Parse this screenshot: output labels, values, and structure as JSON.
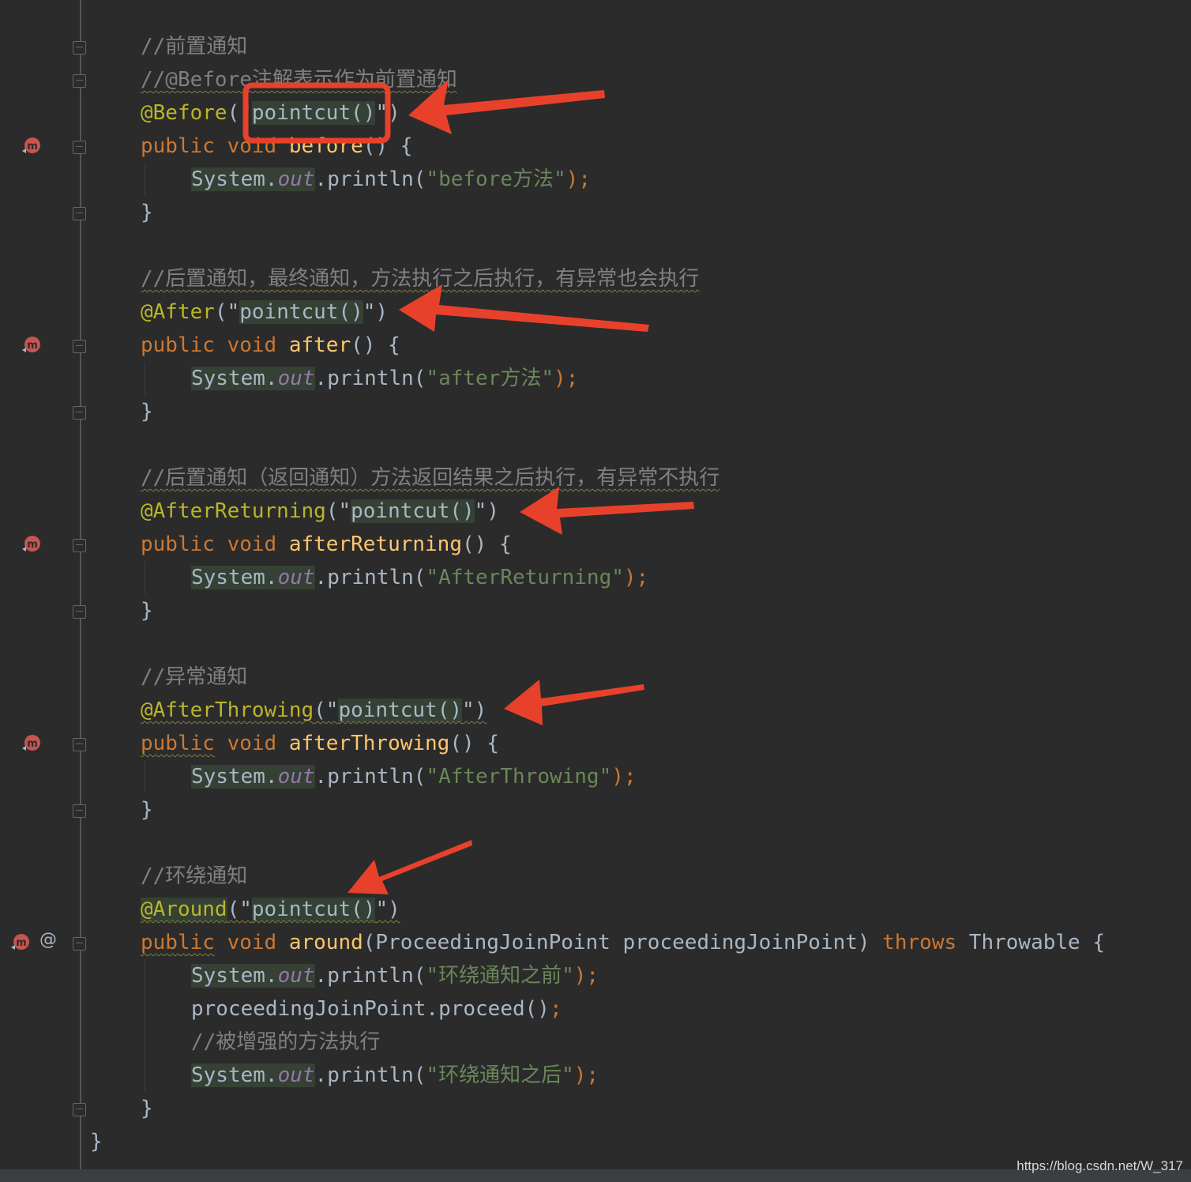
{
  "editor": {
    "lines": [
      {
        "id": "c1",
        "parts": [
          {
            "t": "//前置通知",
            "c": "cmt"
          }
        ]
      },
      {
        "id": "c2",
        "parts": [
          {
            "t": "//@Before注解表示作为前置通知",
            "c": "cmt wavy"
          }
        ]
      },
      {
        "id": "a1",
        "parts": [
          {
            "t": "@Before",
            "c": "ann"
          },
          {
            "t": "(\"",
            "c": "plain"
          },
          {
            "t": "pointcut()",
            "c": "plain hl"
          },
          {
            "t": "\")",
            "c": "plain"
          }
        ]
      },
      {
        "id": "m1",
        "parts": [
          {
            "t": "public void ",
            "c": "kw"
          },
          {
            "t": "before",
            "c": "fn"
          },
          {
            "t": "() {",
            "c": "plain"
          }
        ]
      },
      {
        "id": "s1",
        "parts": [
          {
            "t": "System",
            "c": "plain hl"
          },
          {
            "t": ".",
            "c": "plain hl"
          },
          {
            "t": "out",
            "c": "fld hl"
          },
          {
            "t": ".println(",
            "c": "plain"
          },
          {
            "t": "\"before方法\"",
            "c": "str"
          },
          {
            "t": ");",
            "c": "kw"
          }
        ]
      },
      {
        "id": "e1",
        "parts": [
          {
            "t": "}",
            "c": "plain"
          }
        ]
      },
      {
        "id": "c3",
        "parts": [
          {
            "t": "//后置通知，最终通知，方法执行之后执行，有异常也会执行",
            "c": "cmt wavy"
          }
        ]
      },
      {
        "id": "a2",
        "parts": [
          {
            "t": "@After",
            "c": "ann"
          },
          {
            "t": "(\"",
            "c": "plain"
          },
          {
            "t": "pointcut()",
            "c": "plain hl"
          },
          {
            "t": "\")",
            "c": "plain"
          }
        ]
      },
      {
        "id": "m2",
        "parts": [
          {
            "t": "public void ",
            "c": "kw"
          },
          {
            "t": "after",
            "c": "fn"
          },
          {
            "t": "() {",
            "c": "plain"
          }
        ]
      },
      {
        "id": "s2",
        "parts": [
          {
            "t": "System",
            "c": "plain hl"
          },
          {
            "t": ".",
            "c": "plain hl"
          },
          {
            "t": "out",
            "c": "fld hl"
          },
          {
            "t": ".println(",
            "c": "plain"
          },
          {
            "t": "\"after方法\"",
            "c": "str"
          },
          {
            "t": ");",
            "c": "kw"
          }
        ]
      },
      {
        "id": "e2",
        "parts": [
          {
            "t": "}",
            "c": "plain"
          }
        ]
      },
      {
        "id": "c4",
        "parts": [
          {
            "t": "//后置通知（返回通知）方法返回结果之后执行，有异常不执行",
            "c": "cmt wavy"
          }
        ]
      },
      {
        "id": "a3",
        "parts": [
          {
            "t": "@AfterReturning",
            "c": "ann"
          },
          {
            "t": "(\"",
            "c": "plain"
          },
          {
            "t": "pointcut()",
            "c": "plain hl"
          },
          {
            "t": "\")",
            "c": "plain"
          }
        ]
      },
      {
        "id": "m3",
        "parts": [
          {
            "t": "public void ",
            "c": "kw"
          },
          {
            "t": "afterReturning",
            "c": "fn"
          },
          {
            "t": "() {",
            "c": "plain"
          }
        ]
      },
      {
        "id": "s3",
        "parts": [
          {
            "t": "System",
            "c": "plain hl"
          },
          {
            "t": ".",
            "c": "plain hl"
          },
          {
            "t": "out",
            "c": "fld hl"
          },
          {
            "t": ".println(",
            "c": "plain"
          },
          {
            "t": "\"AfterReturning\"",
            "c": "str"
          },
          {
            "t": ");",
            "c": "kw"
          }
        ]
      },
      {
        "id": "e3",
        "parts": [
          {
            "t": "}",
            "c": "plain"
          }
        ]
      },
      {
        "id": "c5",
        "parts": [
          {
            "t": "//异常通知",
            "c": "cmt"
          }
        ]
      },
      {
        "id": "a4",
        "parts": [
          {
            "t": "@AfterThrowing",
            "c": "ann wavy"
          },
          {
            "t": "(\"",
            "c": "plain wavy"
          },
          {
            "t": "pointcut()",
            "c": "plain hl wavy"
          },
          {
            "t": "\")",
            "c": "plain wavy"
          }
        ]
      },
      {
        "id": "m4",
        "parts": [
          {
            "t": "public",
            "c": "kw wavy"
          },
          {
            "t": " void ",
            "c": "kw"
          },
          {
            "t": "afterThrowing",
            "c": "fn"
          },
          {
            "t": "() {",
            "c": "plain"
          }
        ]
      },
      {
        "id": "s4",
        "parts": [
          {
            "t": "System",
            "c": "plain hl"
          },
          {
            "t": ".",
            "c": "plain hl"
          },
          {
            "t": "out",
            "c": "fld hl"
          },
          {
            "t": ".println(",
            "c": "plain"
          },
          {
            "t": "\"AfterThrowing\"",
            "c": "str"
          },
          {
            "t": ");",
            "c": "kw"
          }
        ]
      },
      {
        "id": "e4",
        "parts": [
          {
            "t": "}",
            "c": "plain"
          }
        ]
      },
      {
        "id": "c6",
        "parts": [
          {
            "t": "//环绕通知",
            "c": "cmt"
          }
        ]
      },
      {
        "id": "a5",
        "parts": [
          {
            "t": "@Around",
            "c": "ann wavy hl"
          },
          {
            "t": "(\"",
            "c": "plain wavy"
          },
          {
            "t": "pointcut()",
            "c": "plain hl wavy"
          },
          {
            "t": "\")",
            "c": "plain wavy"
          }
        ]
      },
      {
        "id": "m5",
        "parts": [
          {
            "t": "public",
            "c": "kw wavy"
          },
          {
            "t": " void ",
            "c": "kw"
          },
          {
            "t": "around",
            "c": "fn"
          },
          {
            "t": "(ProceedingJoinPoint proceedingJoinPoint) ",
            "c": "plain"
          },
          {
            "t": "throws ",
            "c": "kw"
          },
          {
            "t": "Throwable {",
            "c": "plain"
          }
        ]
      },
      {
        "id": "s5",
        "parts": [
          {
            "t": "System",
            "c": "plain hl"
          },
          {
            "t": ".",
            "c": "plain hl"
          },
          {
            "t": "out",
            "c": "fld hl"
          },
          {
            "t": ".println(",
            "c": "plain"
          },
          {
            "t": "\"环绕通知之前\"",
            "c": "str"
          },
          {
            "t": ");",
            "c": "kw"
          }
        ]
      },
      {
        "id": "s6",
        "parts": [
          {
            "t": "proceedingJoinPoint.proceed()",
            "c": "plain"
          },
          {
            "t": ";",
            "c": "kw"
          }
        ]
      },
      {
        "id": "c7",
        "parts": [
          {
            "t": "//被增强的方法执行",
            "c": "cmt"
          }
        ]
      },
      {
        "id": "s7",
        "parts": [
          {
            "t": "System",
            "c": "plain hl"
          },
          {
            "t": ".",
            "c": "plain hl"
          },
          {
            "t": "out",
            "c": "fld hl"
          },
          {
            "t": ".println(",
            "c": "plain"
          },
          {
            "t": "\"环绕通知之后\"",
            "c": "str"
          },
          {
            "t": ");",
            "c": "kw"
          }
        ]
      },
      {
        "id": "e5",
        "parts": [
          {
            "t": "}",
            "c": "plain"
          }
        ]
      },
      {
        "id": "e6",
        "parts": [
          {
            "t": "}",
            "c": "plain"
          }
        ]
      }
    ],
    "gutter_icons": [
      "method-override-icon",
      "method-override-icon",
      "method-override-icon",
      "method-override-icon",
      "method-override-icon"
    ],
    "at_icon": "@"
  },
  "colors": {
    "background": "#2b2b2b",
    "keyword": "#cc7832",
    "method": "#ffc66d",
    "annotation": "#bbb529",
    "string": "#6a8759",
    "comment": "#808080",
    "field": "#9876aa",
    "arrow": "#e8412b"
  },
  "watermark": "https://blog.csdn.net/W_317"
}
